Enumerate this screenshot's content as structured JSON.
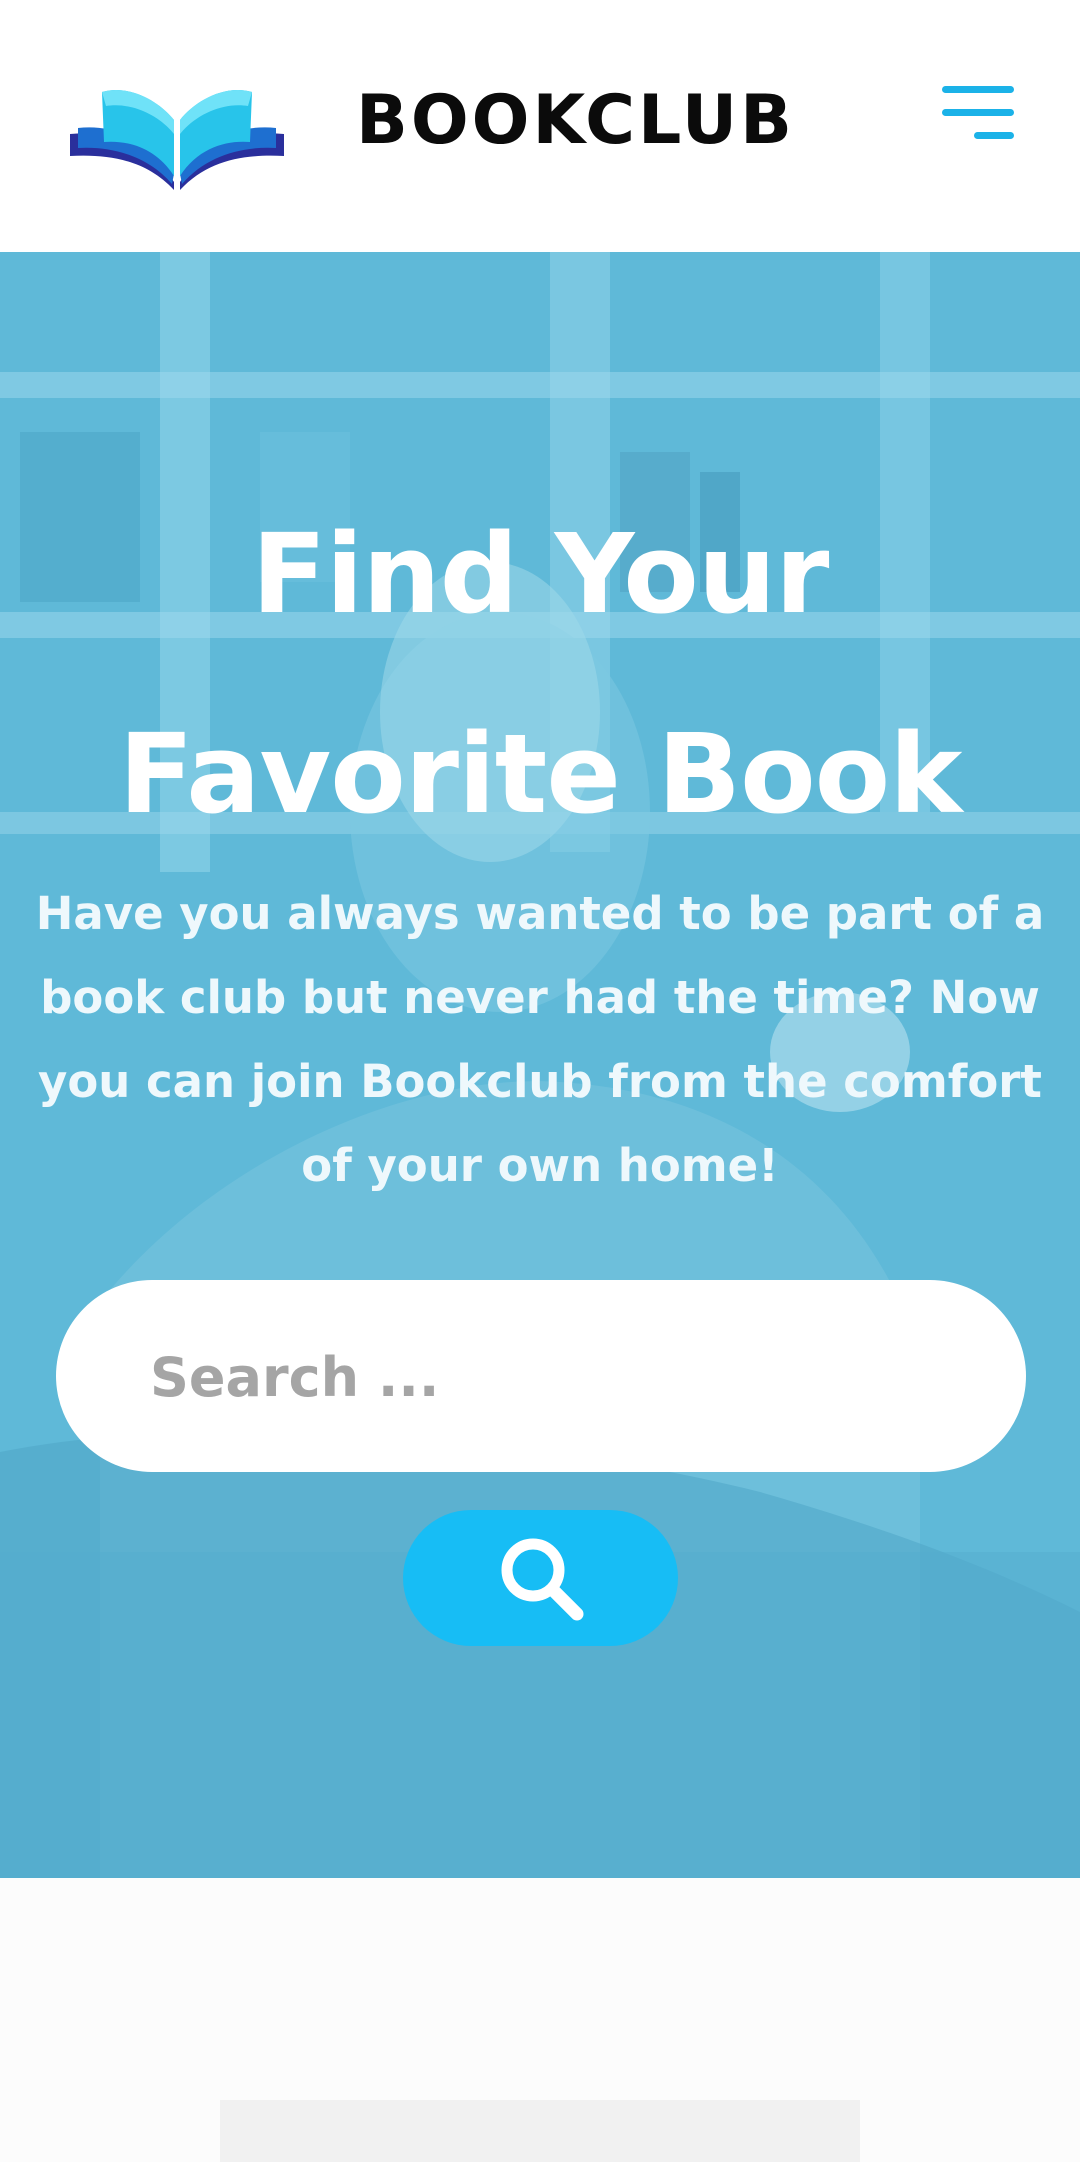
{
  "header": {
    "logo_icon": "open-book-icon",
    "brand": "BOOKCLUB",
    "menu_icon": "hamburger-menu-icon"
  },
  "hero": {
    "title": "Find Your Favorite Book",
    "subtitle": "Have you always wanted to be part of a book club but never had the time? Now you can join Bookclub from the comfort of your own home!",
    "overlay_color": "#5cb6d6"
  },
  "search": {
    "placeholder": "Search ...",
    "value": "",
    "button_icon": "search-icon",
    "button_color": "#17bdf5"
  },
  "colors": {
    "accent": "#17bdf5",
    "logo_light": "#2ed3f0",
    "logo_dark": "#2a3aa8"
  }
}
